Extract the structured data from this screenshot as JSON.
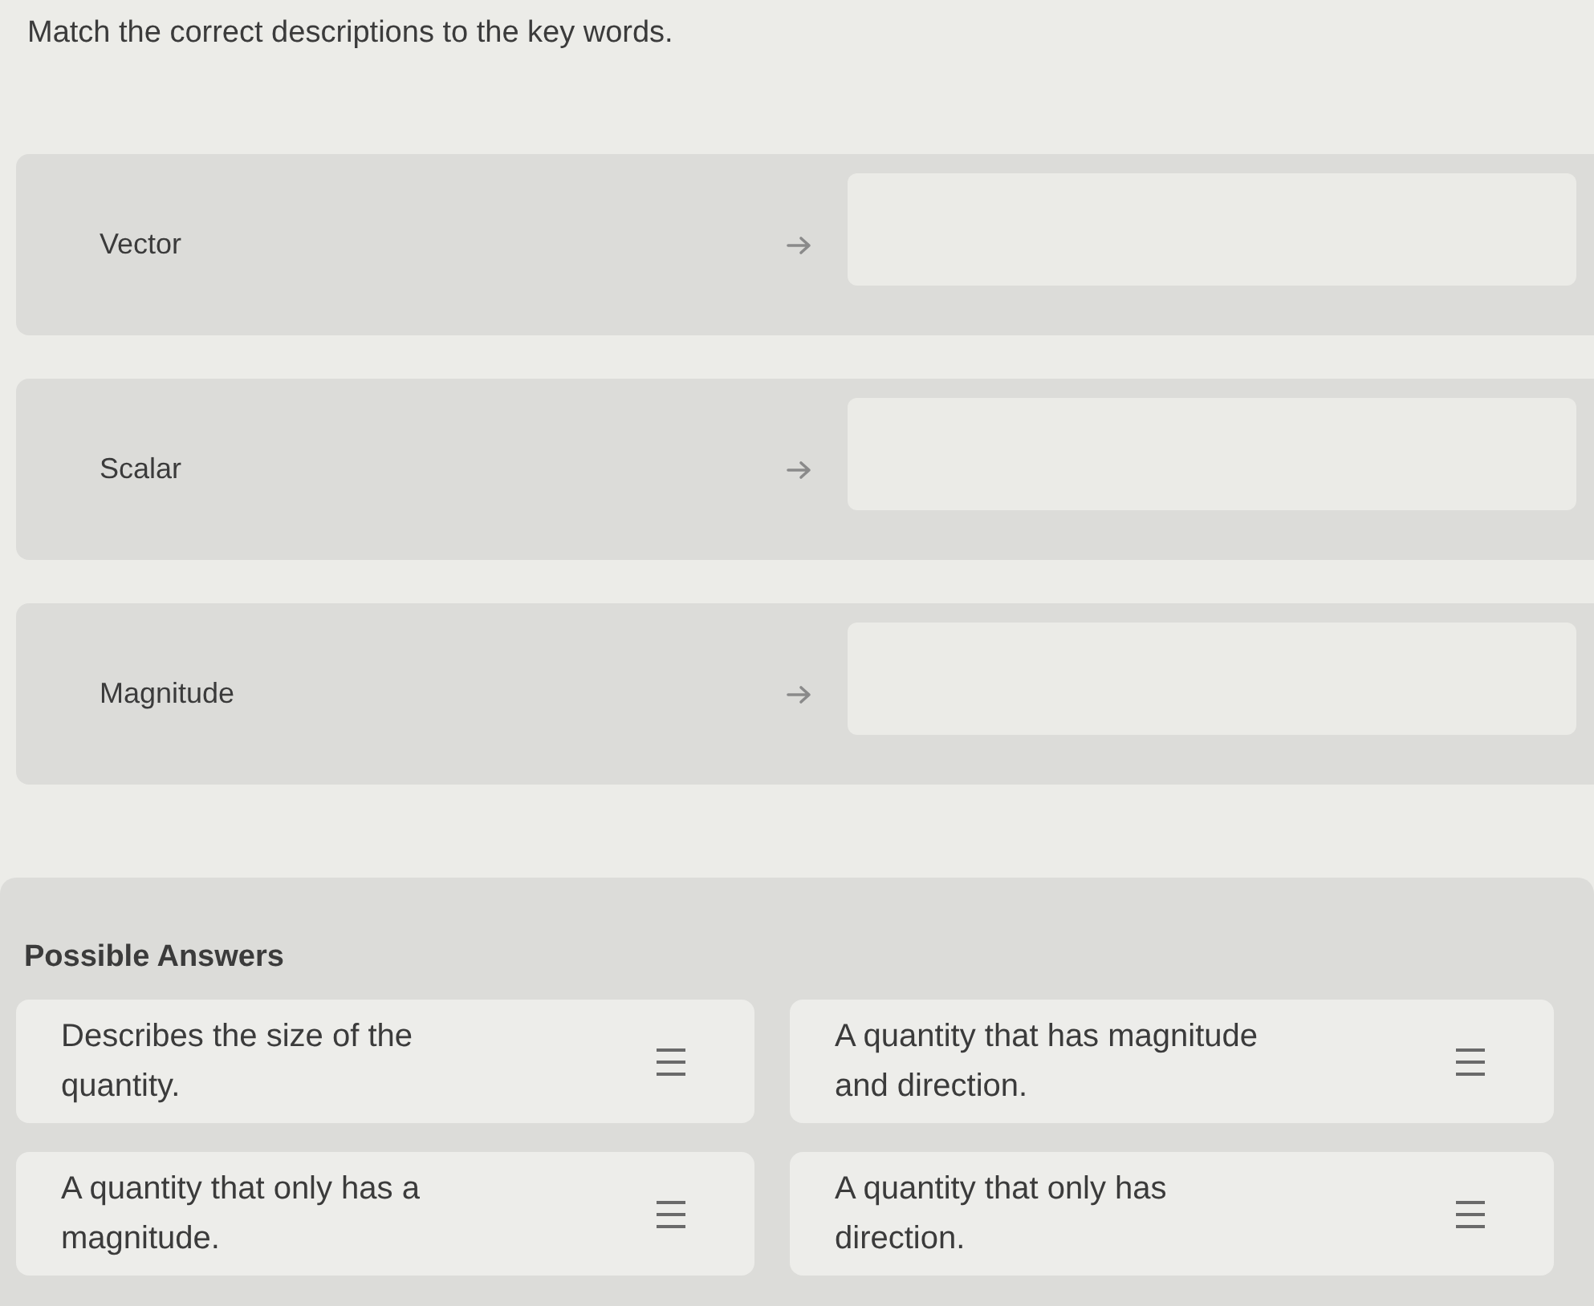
{
  "instruction": "Match the correct descriptions to the key words.",
  "key_words": [
    {
      "term": "Vector"
    },
    {
      "term": "Scalar"
    },
    {
      "term": "Magnitude"
    }
  ],
  "possible_answers": {
    "heading": "Possible Answers",
    "answers": [
      "Describes the size of the quantity.",
      "A quantity that has magnitude and direction.",
      "A quantity that only has a magnitude.",
      "A quantity that only has direction."
    ]
  }
}
